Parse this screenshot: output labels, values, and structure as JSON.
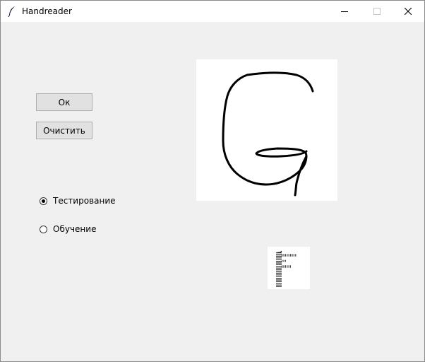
{
  "window": {
    "title": "Handreader",
    "controls": [
      "minimize-icon",
      "maximize-icon",
      "close-icon"
    ]
  },
  "buttons": {
    "ok_label": "Ок",
    "clear_label": "Очистить"
  },
  "mode": {
    "options": [
      {
        "label": "Тестирование",
        "selected": true
      },
      {
        "label": "Обучение",
        "selected": false
      }
    ]
  },
  "drawing": {
    "stroke_color": "#000000",
    "background_color": "#ffffff"
  }
}
